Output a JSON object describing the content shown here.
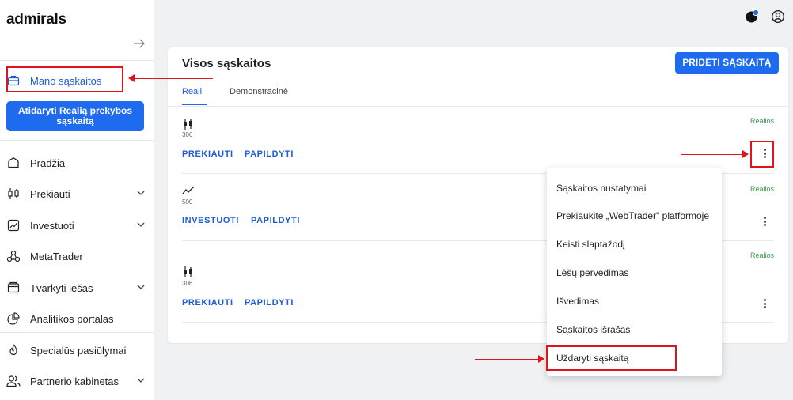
{
  "sidebar": {
    "logo": "admirals",
    "active_item": "Mano sąskaitos",
    "open_account_button": "Atidaryti Realią prekybos sąskaitą",
    "items": [
      {
        "label": "Pradžia",
        "icon": "home-icon",
        "has_chevron": false
      },
      {
        "label": "Prekiauti",
        "icon": "candlestick-icon",
        "has_chevron": true
      },
      {
        "label": "Investuoti",
        "icon": "chart-line-icon",
        "has_chevron": true
      },
      {
        "label": "MetaTrader",
        "icon": "metatrader-icon",
        "has_chevron": false
      },
      {
        "label": "Tvarkyti lėšas",
        "icon": "wallet-icon",
        "has_chevron": true
      },
      {
        "label": "Analitikos portalas",
        "icon": "pie-chart-icon",
        "has_chevron": false
      },
      {
        "label": "Specialūs pasiūlymai",
        "icon": "flame-icon",
        "has_chevron": false
      },
      {
        "label": "Partnerio kabinetas",
        "icon": "users-icon",
        "has_chevron": true
      }
    ]
  },
  "card": {
    "title": "Visos sąskaitos",
    "add_button": "PRIDĖTI SĄSKAITĄ",
    "tabs": [
      {
        "label": "Reali",
        "active": true
      },
      {
        "label": "Demonstracinė",
        "active": false
      }
    ],
    "accounts": [
      {
        "icon": "candlestick-icon",
        "number": "306",
        "status": "Realios",
        "links": [
          "PREKIAUTI",
          "PAPILDYTI"
        ]
      },
      {
        "icon": "chart-line-icon",
        "number": "500",
        "status": "Realios",
        "links": [
          "INVESTUOTI",
          "PAPILDYTI"
        ]
      },
      {
        "icon": "candlestick-icon",
        "number": "306",
        "status": "Realios",
        "links": [
          "PREKIAUTI",
          "PAPILDYTI"
        ]
      }
    ]
  },
  "menu": {
    "items": [
      "Sąskaitos nustatymai",
      "Prekiaukite „WebTrader\" platformoje",
      "Keisti slaptažodį",
      "Lėšų pervedimas",
      "Išvedimas",
      "Sąskaitos išrašas",
      "Uždaryti sąskaitą"
    ]
  },
  "colors": {
    "accent": "#1e6bf0",
    "annotation": "#e0141b",
    "status_green": "#3a9a4a"
  }
}
